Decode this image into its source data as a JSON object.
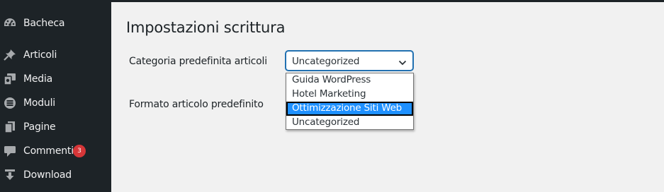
{
  "sidebar": {
    "items": [
      {
        "label": "Bacheca",
        "icon": "dashboard-icon"
      },
      {
        "label": "Articoli",
        "icon": "pin-icon"
      },
      {
        "label": "Media",
        "icon": "media-icon"
      },
      {
        "label": "Moduli",
        "icon": "forms-icon"
      },
      {
        "label": "Pagine",
        "icon": "pages-icon"
      },
      {
        "label": "Commenti",
        "icon": "comment-icon",
        "badge": "3"
      },
      {
        "label": "Download",
        "icon": "download-icon"
      }
    ]
  },
  "main": {
    "title": "Impostazioni scrittura",
    "default_category": {
      "label": "Categoria predefinita articoli",
      "selected": "Uncategorized",
      "options": [
        "Guida WordPress",
        "Hotel Marketing",
        "Ottimizzazione Siti Web",
        "Uncategorized"
      ],
      "highlighted": "Ottimizzazione Siti Web"
    },
    "default_format": {
      "label": "Formato articolo predefinito"
    }
  },
  "colors": {
    "sidebar_bg": "#1d2327",
    "badge": "#d63638",
    "focus": "#2271b1",
    "highlight": "#1e90ff"
  }
}
